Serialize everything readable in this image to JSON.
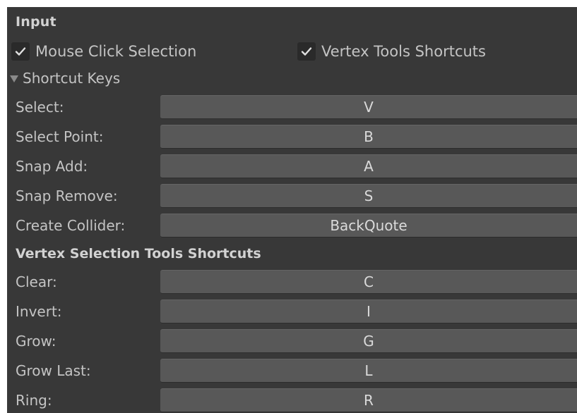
{
  "panel": {
    "header": "Input",
    "toggles": [
      {
        "label": "Mouse Click Selection",
        "checked": true
      },
      {
        "label": "Vertex Tools Shortcuts",
        "checked": true
      }
    ],
    "foldout": {
      "label": "Shortcut Keys",
      "expanded": true
    },
    "shortcut_keys": [
      {
        "label": "Select:",
        "value": "V"
      },
      {
        "label": "Select Point:",
        "value": "B"
      },
      {
        "label": "Snap Add:",
        "value": "A"
      },
      {
        "label": "Snap Remove:",
        "value": "S"
      },
      {
        "label": "Create Collider:",
        "value": "BackQuote"
      }
    ],
    "vertex_section_title": "Vertex Selection Tools Shortcuts",
    "vertex_shortcuts": [
      {
        "label": "Clear:",
        "value": "C"
      },
      {
        "label": "Invert:",
        "value": "I"
      },
      {
        "label": "Grow:",
        "value": "G"
      },
      {
        "label": "Grow Last:",
        "value": "L"
      },
      {
        "label": "Ring:",
        "value": "R"
      }
    ]
  },
  "icons": {
    "checkmark": "check-icon",
    "foldout_arrow": "triangle-down-icon"
  },
  "colors": {
    "panel_bg": "#383838",
    "field_bg": "#585858",
    "checkbox_bg": "#2a2a2a",
    "text": "#c4c4c4",
    "header_text": "#d2d2d2"
  }
}
